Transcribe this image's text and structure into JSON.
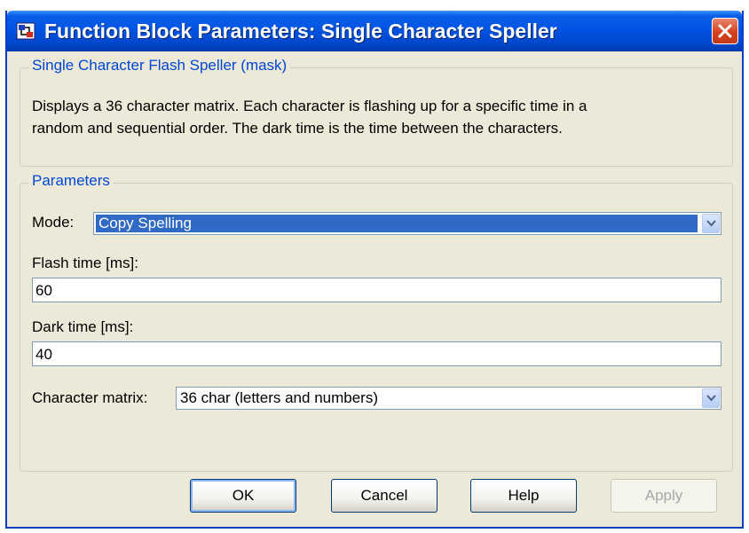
{
  "window": {
    "title": "Function Block Parameters: Single Character Speller",
    "colors": {
      "titlebar": "#0054e3",
      "close": "#d5411c",
      "legend": "#0046d5",
      "selection": "#316ac5"
    }
  },
  "mask_group": {
    "legend": "Single Character Flash Speller (mask)",
    "description_line1": "Displays a 36 character matrix. Each character is flashing up for a specific time in a",
    "description_line2": "random and sequential order. The dark time is the time between the characters."
  },
  "params_group": {
    "legend": "Parameters",
    "mode_label": "Mode:",
    "mode_value": "Copy Spelling",
    "flash_label": "Flash time [ms]:",
    "flash_value": "60",
    "dark_label": "Dark time [ms]:",
    "dark_value": "40",
    "matrix_label": "Character matrix:",
    "matrix_value": "36 char (letters and numbers)"
  },
  "buttons": {
    "ok": "OK",
    "cancel": "Cancel",
    "help": "Help",
    "apply": "Apply"
  },
  "icons": [
    "simulink-block-icon",
    "close-icon",
    "chevron-down-icon"
  ]
}
